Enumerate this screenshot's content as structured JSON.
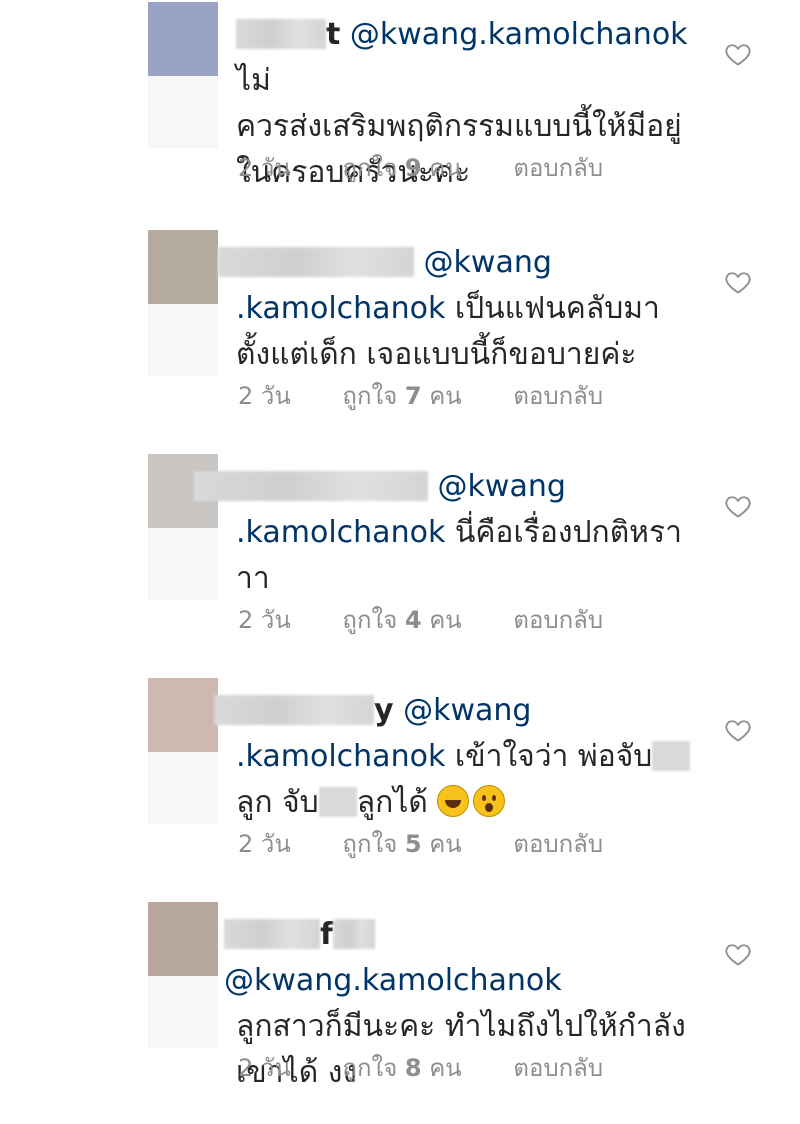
{
  "colors": {
    "mention": "#003569",
    "meta": "#8e8e8e",
    "text": "#262626"
  },
  "comments": [
    {
      "avatar_color": "#9aa3c3",
      "username_tail": "t",
      "mention": "@kwang.kamolchanok",
      "lines": [
        "ไม่",
        "ควรส่งเสริมพฤติกรรมแบบนี้ให้มีอยู่",
        "ในครอบครัวนะคะ"
      ],
      "time": "2 วัน",
      "likes_prefix": "ถูกใจ",
      "likes": "9",
      "likes_suffix": "คน",
      "reply": "ตอบกลับ"
    },
    {
      "avatar_color": "#b5aa9e",
      "username_tail": "",
      "mention_a": "@kwang",
      "mention_b": ".kamolchanok",
      "text_a": "เป็นแฟนคลับมา",
      "text_b": "ตั้งแต่เด็ก เจอแบบนี้ก็ขอบายค่ะ",
      "time": "2 วัน",
      "likes_prefix": "ถูกใจ",
      "likes": "7",
      "likes_suffix": "คน",
      "reply": "ตอบกลับ"
    },
    {
      "avatar_color": "#c9c6c4",
      "username_tail": "",
      "mention_a": "@kwang",
      "mention_b": ".kamolchanok",
      "text_a": "นี่คือเรื่องปกติหรา",
      "text_b": "าา",
      "time": "2 วัน",
      "likes_prefix": "ถูกใจ",
      "likes": "4",
      "likes_suffix": "คน",
      "reply": "ตอบกลับ"
    },
    {
      "avatar_color": "#cdb9b0",
      "username_tail": "y",
      "mention_a": "@kwang",
      "mention_b": ".kamolchanok",
      "text_a": "เข้าใจว่า พ่อจับ",
      "text_b1": "ลูก จับ",
      "text_b2": "ลูกได้",
      "time": "2 วัน",
      "likes_prefix": "ถูกใจ",
      "likes": "5",
      "likes_suffix": "คน",
      "reply": "ตอบกลับ",
      "emoji_names": [
        "laughing-emoji",
        "surprised-emoji"
      ]
    },
    {
      "avatar_color": "#b8a79c",
      "username_tail": "f",
      "mention": "@kwang.kamolchanok",
      "lines": [
        "ลูกสาวก็มีนะคะ ทำไมถึงไปให้กำลัง",
        "เขาได้ งง"
      ],
      "time": "2 วัน",
      "likes_prefix": "ถูกใจ",
      "likes": "8",
      "likes_suffix": "คน",
      "reply": "ตอบกลับ"
    }
  ]
}
